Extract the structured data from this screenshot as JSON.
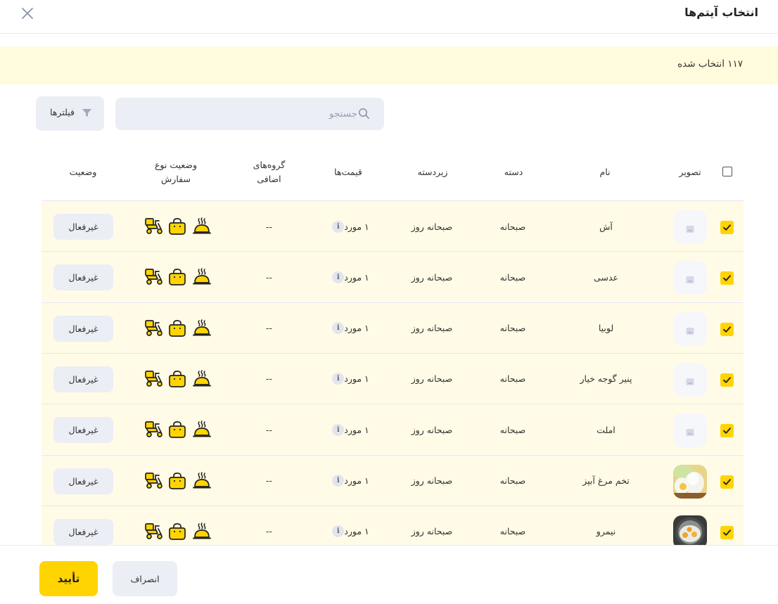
{
  "header": {
    "title": "انتخاب آیتم‌ها"
  },
  "banner": {
    "selected_text": "۱۱۷ انتخاب شده"
  },
  "toolbar": {
    "search_placeholder": "جستجو",
    "filters_label": "فیلترها"
  },
  "table": {
    "columns": {
      "image": "تصویر",
      "name": "نام",
      "category": "دسته",
      "subcategory": "زیردسته",
      "prices": "قیمت‌ها",
      "extra_groups_line1": "گروه‌های",
      "extra_groups_line2": "اضافی",
      "order_type_line1": "وضعیت نوع",
      "order_type_line2": "سفارش",
      "status": "وضعیت"
    },
    "rows": [
      {
        "name": "آش",
        "category": "صبحانه",
        "subcategory": "صبحانه روز",
        "price": "۱ مورد",
        "extra_groups": "--",
        "status": "غیرفعال",
        "image": "placeholder",
        "checked": true
      },
      {
        "name": "عدسی",
        "category": "صبحانه",
        "subcategory": "صبحانه روز",
        "price": "۱ مورد",
        "extra_groups": "--",
        "status": "غیرفعال",
        "image": "placeholder",
        "checked": true
      },
      {
        "name": "لوبیا",
        "category": "صبحانه",
        "subcategory": "صبحانه روز",
        "price": "۱ مورد",
        "extra_groups": "--",
        "status": "غیرفعال",
        "image": "placeholder",
        "checked": true
      },
      {
        "name": "پنیر گوجه خیار",
        "category": "صبحانه",
        "subcategory": "صبحانه روز",
        "price": "۱ مورد",
        "extra_groups": "--",
        "status": "غیرفعال",
        "image": "placeholder",
        "checked": true
      },
      {
        "name": "املت",
        "category": "صبحانه",
        "subcategory": "صبحانه روز",
        "price": "۱ مورد",
        "extra_groups": "--",
        "status": "غیرفعال",
        "image": "placeholder",
        "checked": true
      },
      {
        "name": "تخم مرغ آبپز",
        "category": "صبحانه",
        "subcategory": "صبحانه روز",
        "price": "۱ مورد",
        "extra_groups": "--",
        "status": "غیرفعال",
        "image": "boiled-egg-photo",
        "checked": true
      },
      {
        "name": "نیمرو",
        "category": "صبحانه",
        "subcategory": "صبحانه روز",
        "price": "۱ مورد",
        "extra_groups": "--",
        "status": "غیرفعال",
        "image": "fried-egg-photo",
        "checked": true
      }
    ]
  },
  "footer": {
    "confirm_label": "تأیید",
    "cancel_label": "انصراف"
  },
  "colors": {
    "accent": "#ffd400",
    "banner_bg": "#fffbdc",
    "row_selected_bg": "#fffbe6",
    "button_gray": "#eceef5"
  },
  "icons": {
    "close": "close-x-icon",
    "search": "search-icon",
    "filter": "filter-funnel-icon",
    "order_types": [
      "delivery-scooter-icon",
      "takeaway-bag-icon",
      "dine-in-cloche-icon"
    ],
    "info": "info-icon",
    "image_placeholder": "image-placeholder-icon"
  }
}
